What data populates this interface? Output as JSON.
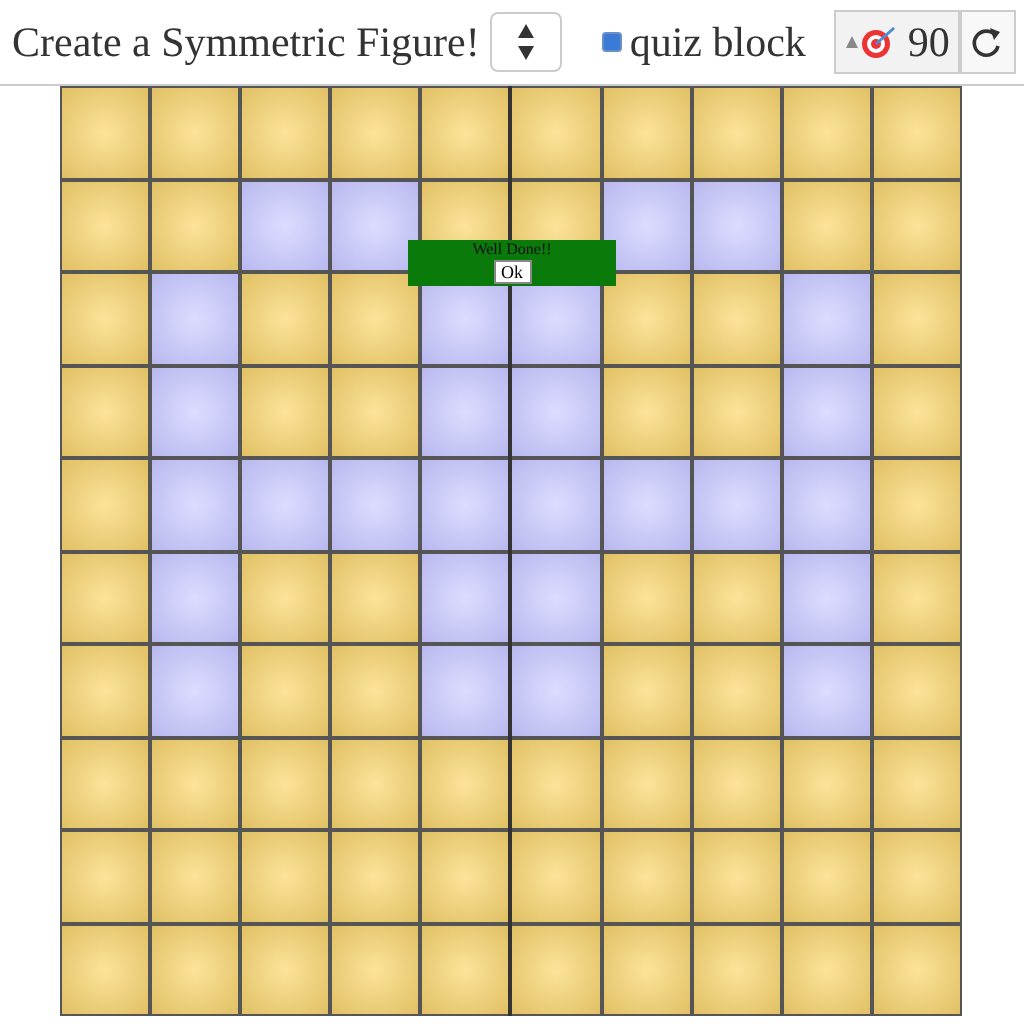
{
  "header": {
    "title": "Create a Symmetric Figure!",
    "quiz": {
      "label": "quiz block",
      "checked": true
    },
    "score": "90"
  },
  "popup": {
    "message": "Well Done!!",
    "button": "Ok"
  },
  "grid": [
    [
      false,
      false,
      false,
      false,
      false,
      false,
      false,
      false,
      false,
      false
    ],
    [
      false,
      false,
      true,
      true,
      false,
      false,
      true,
      true,
      false,
      false
    ],
    [
      false,
      true,
      false,
      false,
      true,
      true,
      false,
      false,
      true,
      false
    ],
    [
      false,
      true,
      false,
      false,
      true,
      true,
      false,
      false,
      true,
      false
    ],
    [
      false,
      true,
      true,
      true,
      true,
      true,
      true,
      true,
      true,
      false
    ],
    [
      false,
      true,
      false,
      false,
      true,
      true,
      false,
      false,
      true,
      false
    ],
    [
      false,
      true,
      false,
      false,
      true,
      true,
      false,
      false,
      true,
      false
    ],
    [
      false,
      false,
      false,
      false,
      false,
      false,
      false,
      false,
      false,
      false
    ],
    [
      false,
      false,
      false,
      false,
      false,
      false,
      false,
      false,
      false,
      false
    ],
    [
      false,
      false,
      false,
      false,
      false,
      false,
      false,
      false,
      false,
      false
    ]
  ]
}
